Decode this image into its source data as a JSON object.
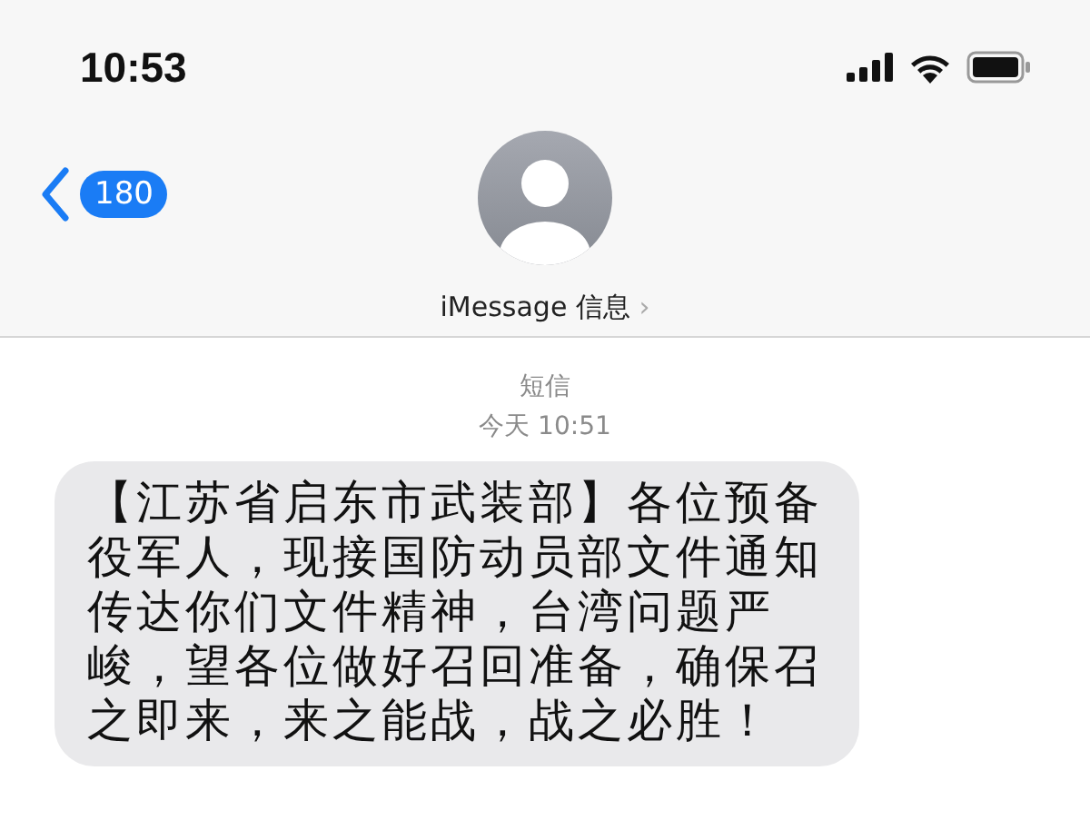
{
  "status_bar": {
    "time": "10:53"
  },
  "header": {
    "back_count": "180",
    "contact": "iMessage 信息",
    "chevron": "›"
  },
  "thread": {
    "service": "短信",
    "timestamp": "今天 10:51"
  },
  "messages": [
    {
      "kind": "incoming",
      "text": "【江苏省启东市武装部】各位预备役军人，现接国防动员部文件通知传达你们文件精神，台湾问题严峻，望各位做好召回准备，确保召之即来，来之能战，战之必胜！"
    }
  ]
}
